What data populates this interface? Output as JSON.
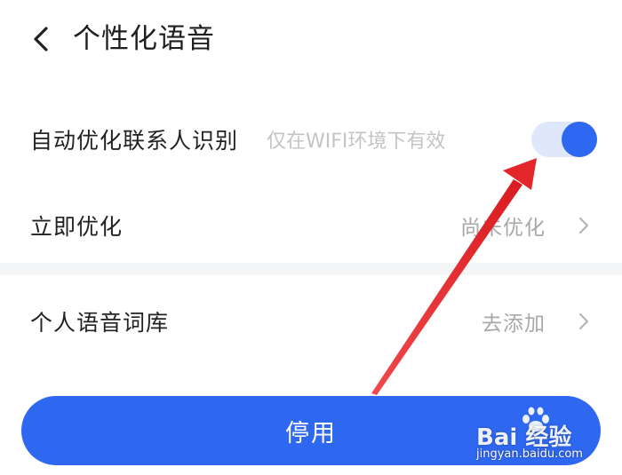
{
  "header": {
    "title": "个性化语音",
    "back_icon": "chevron-left-icon"
  },
  "settings": {
    "auto_optimize": {
      "label": "自动优化联系人识别",
      "hint": "仅在WIFI环境下有效",
      "enabled": true
    },
    "optimize_now": {
      "label": "立即优化",
      "value": "尚未优化"
    },
    "personal_lexicon": {
      "label": "个人语音词库",
      "value": "去添加"
    }
  },
  "actions": {
    "primary_label": "停用"
  },
  "watermark": {
    "brand": "Bai 经验",
    "url": "jingyan.baidu.com"
  },
  "colors": {
    "accent": "#2e67f0",
    "toggle_track": "#dfe8fb",
    "annotation_arrow": "#e3262a"
  }
}
